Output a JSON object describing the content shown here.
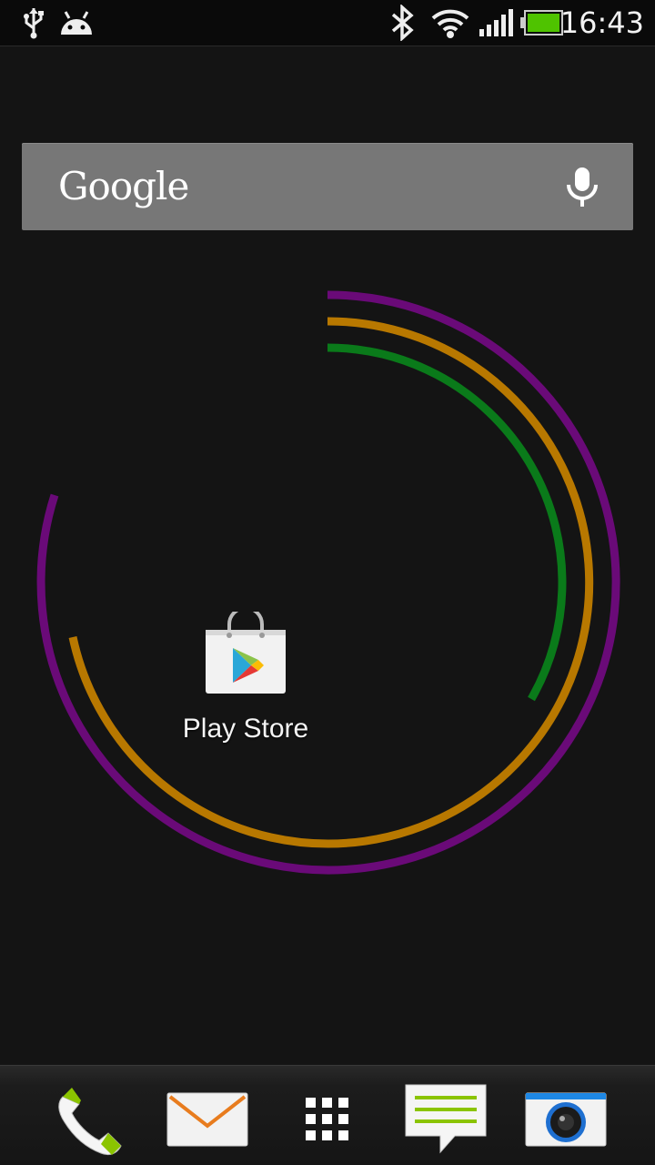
{
  "status_bar": {
    "time": "16:43",
    "left_icons": [
      "usb-icon",
      "android-debug-icon"
    ],
    "right_icons": [
      "bluetooth-icon",
      "wifi-icon",
      "signal-icon",
      "battery-icon"
    ],
    "battery_color": "#4fc300"
  },
  "search": {
    "brand": "Google",
    "mic_icon": "microphone-icon"
  },
  "wallpaper": {
    "ring_colors": [
      "#6a0a78",
      "#b87800",
      "#0a7a1a"
    ]
  },
  "apps": [
    {
      "label": "Play Store",
      "icon": "play-store-icon"
    }
  ],
  "dock": {
    "items": [
      {
        "name": "phone",
        "icon": "phone-icon"
      },
      {
        "name": "mail",
        "icon": "mail-icon"
      },
      {
        "name": "all-apps",
        "icon": "app-drawer-icon"
      },
      {
        "name": "messages",
        "icon": "messages-icon"
      },
      {
        "name": "camera",
        "icon": "camera-icon"
      }
    ]
  }
}
